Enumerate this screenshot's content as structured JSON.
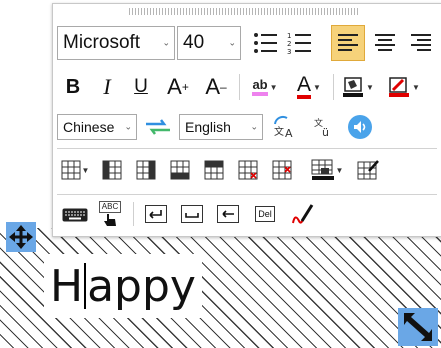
{
  "format": {
    "font_family": "Microsoft",
    "font_size": "40",
    "bold": "B",
    "italic": "I",
    "underline": "U",
    "superscript_letter": "A",
    "superscript_mark": "+",
    "subscript_letter": "A",
    "subscript_mark": "–",
    "highlight_label": "ab",
    "font_color_letter": "A"
  },
  "translate": {
    "source_language": "Chinese",
    "target_language": "English"
  },
  "tools": {
    "spellcheck_label": "ABC",
    "delete_label": "Del"
  },
  "document": {
    "text_before_caret": "H",
    "text_after_caret": "appy"
  },
  "colors": {
    "accent_active": "#f6d27a",
    "handle": "#6aa7e6",
    "highlight": "#ee82ee",
    "font_color": "#e00000",
    "speaker": "#4aa3ea"
  }
}
